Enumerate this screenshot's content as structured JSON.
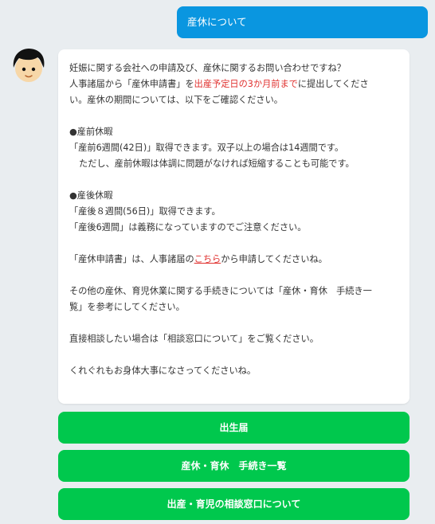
{
  "user_message": "産休について",
  "bot": {
    "lines": {
      "l1": "妊娠に関する会社への申請及び、産休に関するお問い合わせですね？",
      "l2a": "人事諸届から「産休申請書」を",
      "l2b": "出産予定日の3か月前まで",
      "l2c": "に提出してくださ",
      "l3": "い。産休の期間については、以下をご確認ください。",
      "l4": "●産前休暇",
      "l5": "「産前6週間(42日)」取得できます。双子以上の場合は14週間です。",
      "l6": "ただし、産前休暇は体調に問題がなければ短縮することも可能です。",
      "l7": "●産後休暇",
      "l8": "「産後８週間(56日)」取得できます。",
      "l9": "「産後6週間」は義務になっていますのでご注意ください。",
      "l10a": "「産休申請書」は、人事諸届の",
      "l10b": "こちら",
      "l10c": "から申請してくださいね。",
      "l11": "その他の産休、育児休業に関する手続きについては「産休・育休　手続き一",
      "l12": "覧」を参考にしてください。",
      "l13": "直接相談したい場合は「相談窓口について」をご覧ください。",
      "l14": "くれぐれもお身体大事になさってくださいね。"
    }
  },
  "buttons": {
    "b1": "出生届",
    "b2": "産休・育休　手続き一覧",
    "b3": "出産・育児の相談窓口について"
  },
  "colors": {
    "user_bubble": "#0a96e0",
    "button": "#00c84d",
    "emphasis": "#e0302e"
  }
}
